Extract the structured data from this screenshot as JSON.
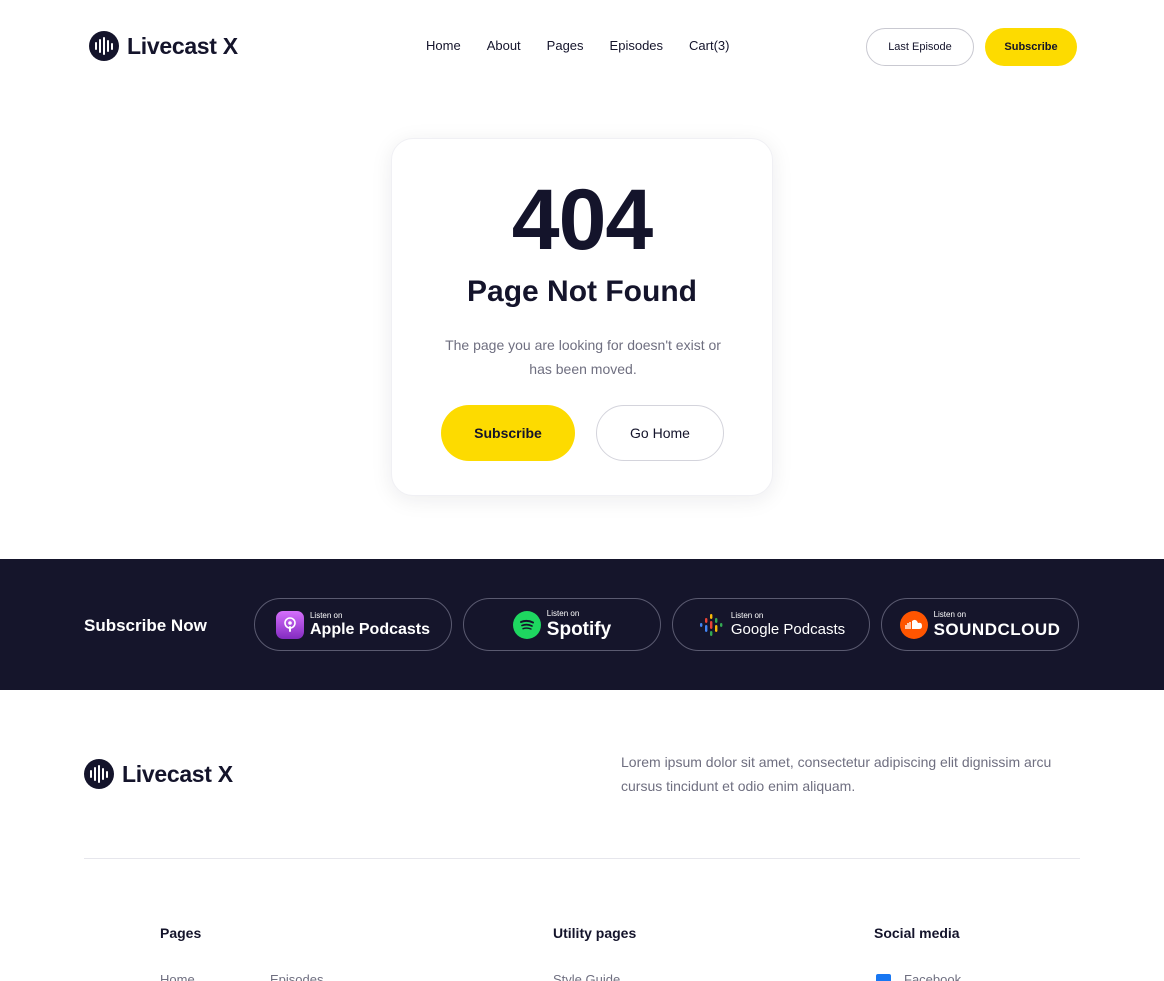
{
  "header": {
    "brand": "Livecast X",
    "nav": [
      "Home",
      "About",
      "Pages",
      "Episodes",
      "Cart(3)"
    ],
    "last_episode_label": "Last Episode",
    "subscribe_label": "Subscribe"
  },
  "error_card": {
    "code": "404",
    "title": "Page Not Found",
    "description": "The page you are looking for doesn't exist or has been moved.",
    "subscribe_label": "Subscribe",
    "home_label": "Go Home"
  },
  "subscribe_band": {
    "title": "Subscribe Now",
    "platforms": [
      {
        "small": "Listen on",
        "name": "Apple Podcasts",
        "icon": "apple-podcasts-icon"
      },
      {
        "small": "Listen on",
        "name": "Spotify",
        "icon": "spotify-icon"
      },
      {
        "small": "Listen on",
        "name": "Google Podcasts",
        "icon": "google-podcasts-icon"
      },
      {
        "small": "Listen on",
        "name": "SOUNDCLOUD",
        "icon": "soundcloud-icon"
      }
    ]
  },
  "footer": {
    "brand": "Livecast X",
    "description": "Lorem ipsum dolor sit amet, consectetur adipiscing elit dignissim arcu cursus tincidunt et odio enim aliquam.",
    "columns": [
      {
        "heading": "Pages",
        "links": [
          "Home",
          "Episodes"
        ]
      },
      {
        "heading": "Utility pages",
        "links": [
          "Style Guide"
        ]
      },
      {
        "heading": "Social media",
        "links": [
          "Facebook"
        ]
      }
    ]
  },
  "colors": {
    "accent": "#fddb00",
    "dark": "#14142b",
    "band_bg": "#15152b"
  }
}
